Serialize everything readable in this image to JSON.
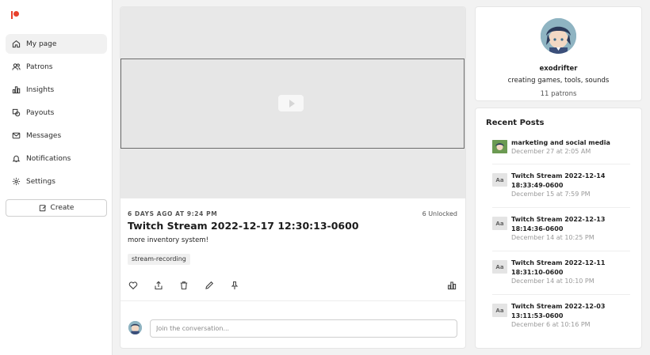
{
  "sidebar": {
    "items": [
      {
        "label": "My page",
        "icon": "home-icon",
        "active": true
      },
      {
        "label": "Patrons",
        "icon": "people-icon"
      },
      {
        "label": "Insights",
        "icon": "chart-icon"
      },
      {
        "label": "Payouts",
        "icon": "payouts-icon"
      },
      {
        "label": "Messages",
        "icon": "mail-icon"
      },
      {
        "label": "Notifications",
        "icon": "bell-icon"
      },
      {
        "label": "Settings",
        "icon": "gear-icon"
      }
    ],
    "create_label": "Create"
  },
  "post": {
    "meta": "6 DAYS AGO AT 9:24 PM",
    "unlocked_count": "6",
    "unlocked_label": "Unlocked",
    "title": "Twitch Stream 2022-12-17 12:30:13-0600",
    "body": "more inventory system!",
    "tag": "stream-recording",
    "comment_placeholder": "Join the conversation..."
  },
  "profile": {
    "name": "exodrifter",
    "tagline": "creating games, tools, sounds",
    "patrons": "11 patrons"
  },
  "recent": {
    "title": "Recent Posts",
    "thumb_label": "Aa",
    "posts": [
      {
        "title": "marketing and social media",
        "date": "December 27 at 2:05 AM"
      },
      {
        "title": "Twitch Stream 2022-12-14 18:33:49-0600",
        "date": "December 15 at 7:59 PM"
      },
      {
        "title": "Twitch Stream 2022-12-13 18:14:36-0600",
        "date": "December 14 at 10:25 PM"
      },
      {
        "title": "Twitch Stream 2022-12-11 18:31:10-0600",
        "date": "December 14 at 10:10 PM"
      },
      {
        "title": "Twitch Stream 2022-12-03 13:11:53-0600",
        "date": "December 6 at 10:16 PM"
      }
    ]
  },
  "colors": {
    "brand": "#e8412c",
    "background": "#f2f2f2",
    "card": "#ffffff"
  }
}
